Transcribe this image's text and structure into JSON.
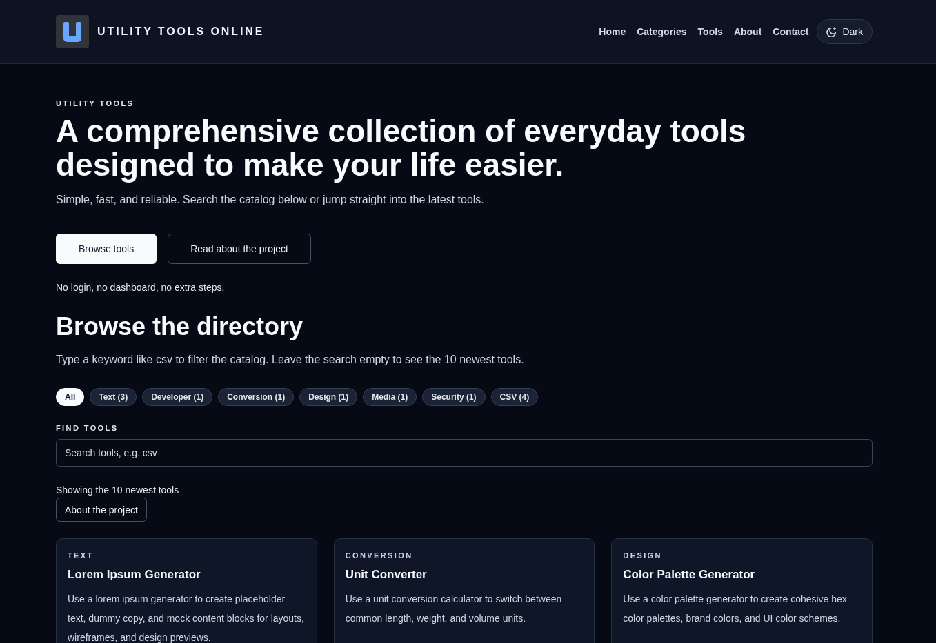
{
  "header": {
    "brand": "UTILITY TOOLS ONLINE",
    "nav": [
      {
        "label": "Home"
      },
      {
        "label": "Categories"
      },
      {
        "label": "Tools"
      },
      {
        "label": "About"
      },
      {
        "label": "Contact"
      }
    ],
    "theme_button": {
      "label": "Dark"
    }
  },
  "hero": {
    "eyebrow": "UTILITY TOOLS",
    "title": "A comprehensive collection of everyday tools designed to make your life easier.",
    "subtitle": "Simple, fast, and reliable. Search the catalog below or jump straight into the latest tools.",
    "actions": [
      {
        "label": "Browse tools",
        "kind": "primary"
      },
      {
        "label": "Read about the project",
        "kind": "secondary"
      }
    ],
    "note": "No login, no dashboard, no extra steps."
  },
  "directory": {
    "title": "Browse the directory",
    "intro": "Type a keyword like csv to filter the catalog. Leave the search empty to see the 10 newest tools.",
    "filters": [
      {
        "label": "All",
        "selected": true
      },
      {
        "label": "Text (3)",
        "selected": false
      },
      {
        "label": "Developer (1)",
        "selected": false
      },
      {
        "label": "Conversion (1)",
        "selected": false
      },
      {
        "label": "Design (1)",
        "selected": false
      },
      {
        "label": "Media (1)",
        "selected": false
      },
      {
        "label": "Security (1)",
        "selected": false
      },
      {
        "label": "CSV (4)",
        "selected": false
      }
    ],
    "search": {
      "label": "FIND TOOLS",
      "placeholder": "Search tools, e.g. csv"
    },
    "status": "Showing the 10 newest tools",
    "about_button": "About the project",
    "cards": [
      {
        "category": "TEXT",
        "title": "Lorem Ipsum Generator",
        "description": "Use a lorem ipsum generator to create placeholder text, dummy copy, and mock content blocks for layouts, wireframes, and design previews."
      },
      {
        "category": "CONVERSION",
        "title": "Unit Converter",
        "description": "Use a unit conversion calculator to switch between common length, weight, and volume units."
      },
      {
        "category": "DESIGN",
        "title": "Color Palette Generator",
        "description": "Use a color palette generator to create cohesive hex color palettes, brand colors, and UI color schemes."
      }
    ]
  }
}
